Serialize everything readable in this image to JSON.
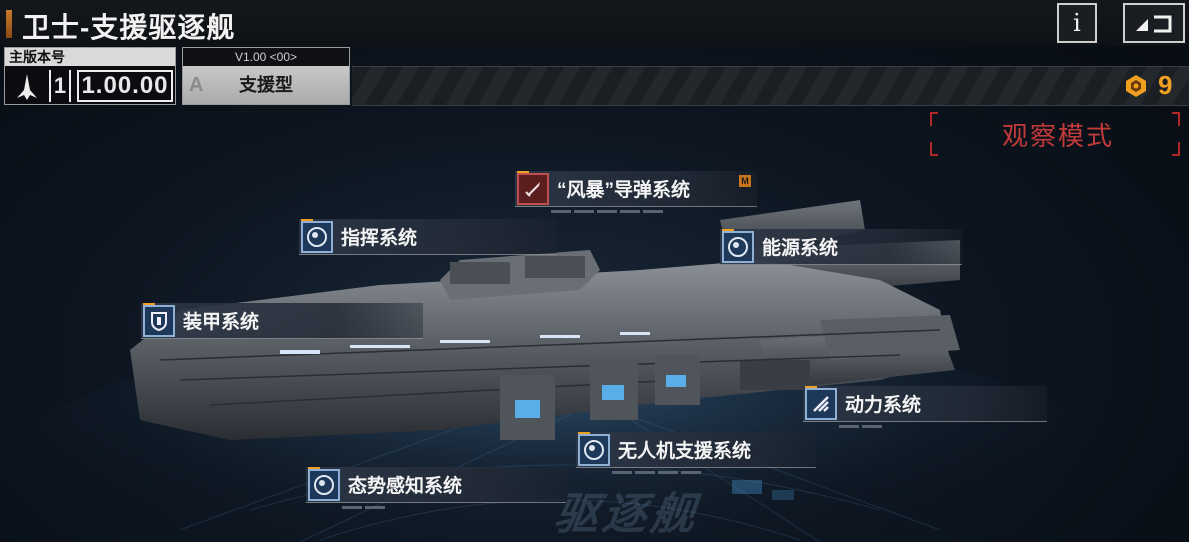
{
  "header": {
    "title": "卫士-支援驱逐舰",
    "info_label": "i",
    "back_label": "◢⊐"
  },
  "version": {
    "label": "主版本号",
    "major": "1",
    "minor": "1.00.00"
  },
  "mode": {
    "version_code": "V1.00 <00>",
    "letter": "A",
    "type": "支援型"
  },
  "currency": {
    "icon": "crest-coin-icon",
    "count": "9",
    "color": "#f0a020"
  },
  "observe_mode": {
    "label": "观察模式",
    "color": "#c03a3a"
  },
  "floor_watermark": "驱逐舰",
  "systems": [
    {
      "label": "“风暴”导弹系统",
      "icon": "missile-icon",
      "badge": "M"
    },
    {
      "label": "指挥系统",
      "icon": "radar-icon"
    },
    {
      "label": "能源系统",
      "icon": "radar-icon"
    },
    {
      "label": "装甲系统",
      "icon": "shield-icon"
    },
    {
      "label": "动力系统",
      "icon": "thruster-icon"
    },
    {
      "label": "无人机支援系统",
      "icon": "radar-icon"
    },
    {
      "label": "态势感知系统",
      "icon": "radar-icon"
    }
  ]
}
